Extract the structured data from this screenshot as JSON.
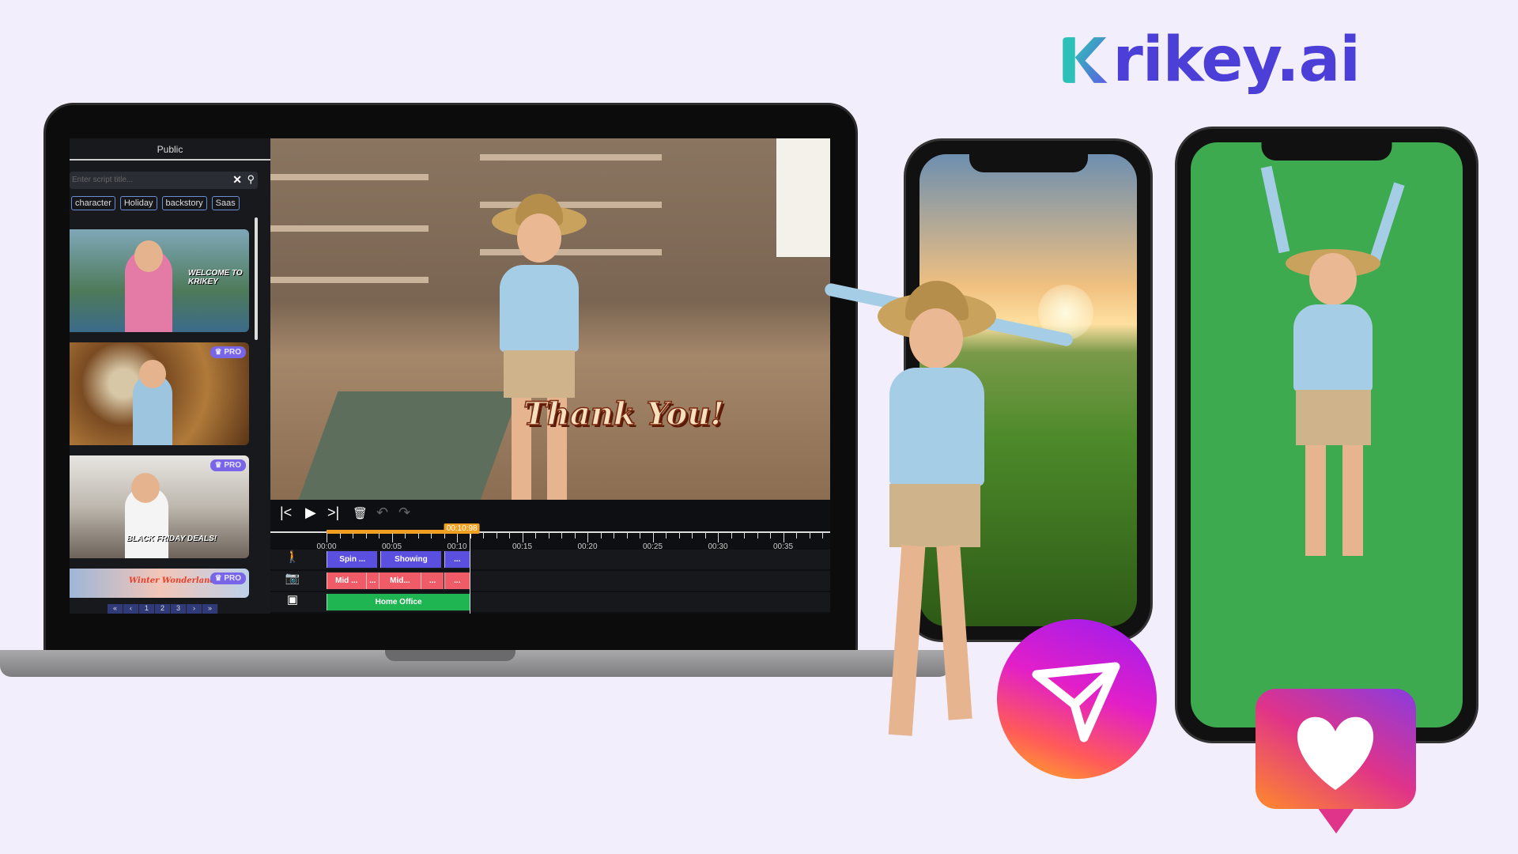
{
  "brand": {
    "logo_text": "rikey.ai",
    "logo_full": "Krikey.ai",
    "accent": "#4b3fd8"
  },
  "panel": {
    "header": "Public",
    "search_placeholder": "Enter script title...",
    "tags": [
      "character",
      "Holiday",
      "backstory",
      "Saas"
    ],
    "thumbnails": [
      {
        "caption": "WELCOME TO KRIKEY",
        "pro": false
      },
      {
        "caption": "",
        "pro": true,
        "badge": "PRO"
      },
      {
        "caption": "BLACK FRIDAY DEALS!",
        "pro": true,
        "badge": "PRO"
      },
      {
        "caption": "Winter Wonderland",
        "pro": true,
        "badge": "PRO"
      }
    ],
    "pagination": [
      "«",
      "‹",
      "1",
      "2",
      "3",
      "›",
      "»"
    ]
  },
  "viewport": {
    "overlay_text": "Thank You!"
  },
  "timeline": {
    "controls": [
      "skip-back-icon",
      "play-icon",
      "skip-forward-icon",
      "trash-icon",
      "undo-icon",
      "redo-icon"
    ],
    "playhead_label": "00:10:98",
    "playhead_seconds": 10.98,
    "tick_labels": [
      "00:00",
      "00:05",
      "00:10",
      "00:15",
      "00:20",
      "00:25",
      "00:30",
      "00:35"
    ],
    "tracks": [
      {
        "icon": "character-icon",
        "color": "#5b4fe0",
        "clips": [
          {
            "label": "Spin ...",
            "start": 0,
            "end": 3.9
          },
          {
            "label": "Showing",
            "start": 4.1,
            "end": 8.8
          },
          {
            "label": "...",
            "start": 9.0,
            "end": 10.98
          }
        ]
      },
      {
        "icon": "camera-icon",
        "color": "#ef5b66",
        "clips": [
          {
            "label": "Mid ...",
            "start": 0,
            "end": 3.0
          },
          {
            "label": "...",
            "start": 3.0,
            "end": 4.0
          },
          {
            "label": "Mid...",
            "start": 4.0,
            "end": 7.2
          },
          {
            "label": "...",
            "start": 7.2,
            "end": 9.0
          },
          {
            "label": "...",
            "start": 9.0,
            "end": 10.98
          }
        ]
      },
      {
        "icon": "scene-icon",
        "color": "#1fb553",
        "clips": [
          {
            "label": "Home Office",
            "start": 0,
            "end": 10.98
          }
        ]
      }
    ]
  }
}
